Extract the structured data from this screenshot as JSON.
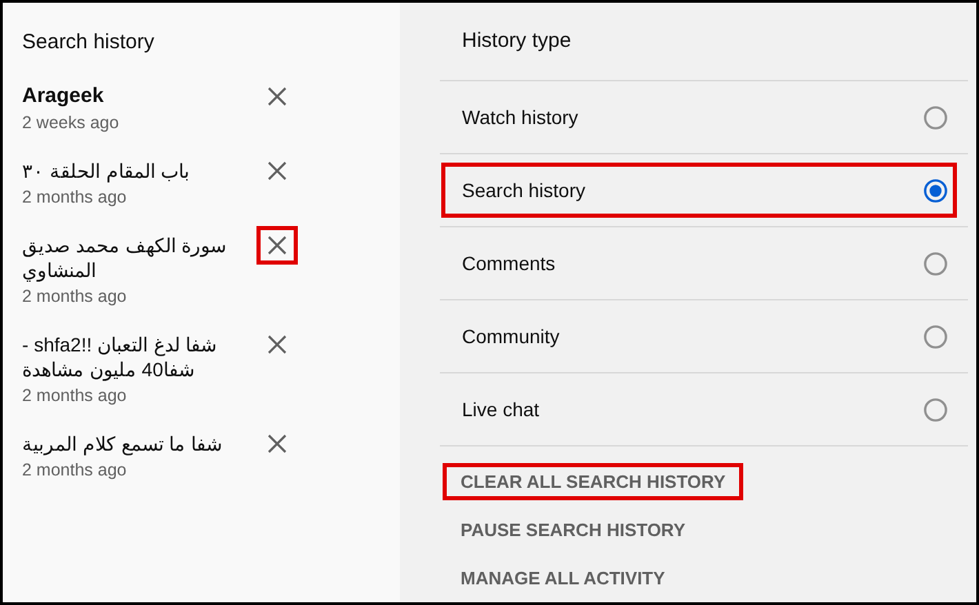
{
  "search_history": {
    "title": "Search history",
    "items": [
      {
        "query": "Arageek",
        "time": "2 weeks ago",
        "highlighted": false
      },
      {
        "query": "باب المقام الحلقة ٣٠",
        "time": "2 months ago",
        "highlighted": false
      },
      {
        "query": "سورة الكهف محمد صديق المنشاوي",
        "time": "2 months ago",
        "highlighted": true
      },
      {
        "query": "شفا لدغ التعبان !!shfa2 - شفا40 مليون مشاهدة",
        "time": "2 months ago",
        "highlighted": false
      },
      {
        "query": "شفا ما تسمع كلام المربية",
        "time": "2 months ago",
        "highlighted": false
      }
    ]
  },
  "history_type": {
    "title": "History type",
    "options": [
      {
        "label": "Watch history",
        "selected": false,
        "highlighted": false
      },
      {
        "label": "Search history",
        "selected": true,
        "highlighted": true
      },
      {
        "label": "Comments",
        "selected": false,
        "highlighted": false
      },
      {
        "label": "Community",
        "selected": false,
        "highlighted": false
      },
      {
        "label": "Live chat",
        "selected": false,
        "highlighted": false
      }
    ],
    "actions": [
      {
        "label": "CLEAR ALL SEARCH HISTORY",
        "highlighted": true
      },
      {
        "label": "PAUSE SEARCH HISTORY",
        "highlighted": false
      },
      {
        "label": "MANAGE ALL ACTIVITY",
        "highlighted": false
      }
    ]
  }
}
